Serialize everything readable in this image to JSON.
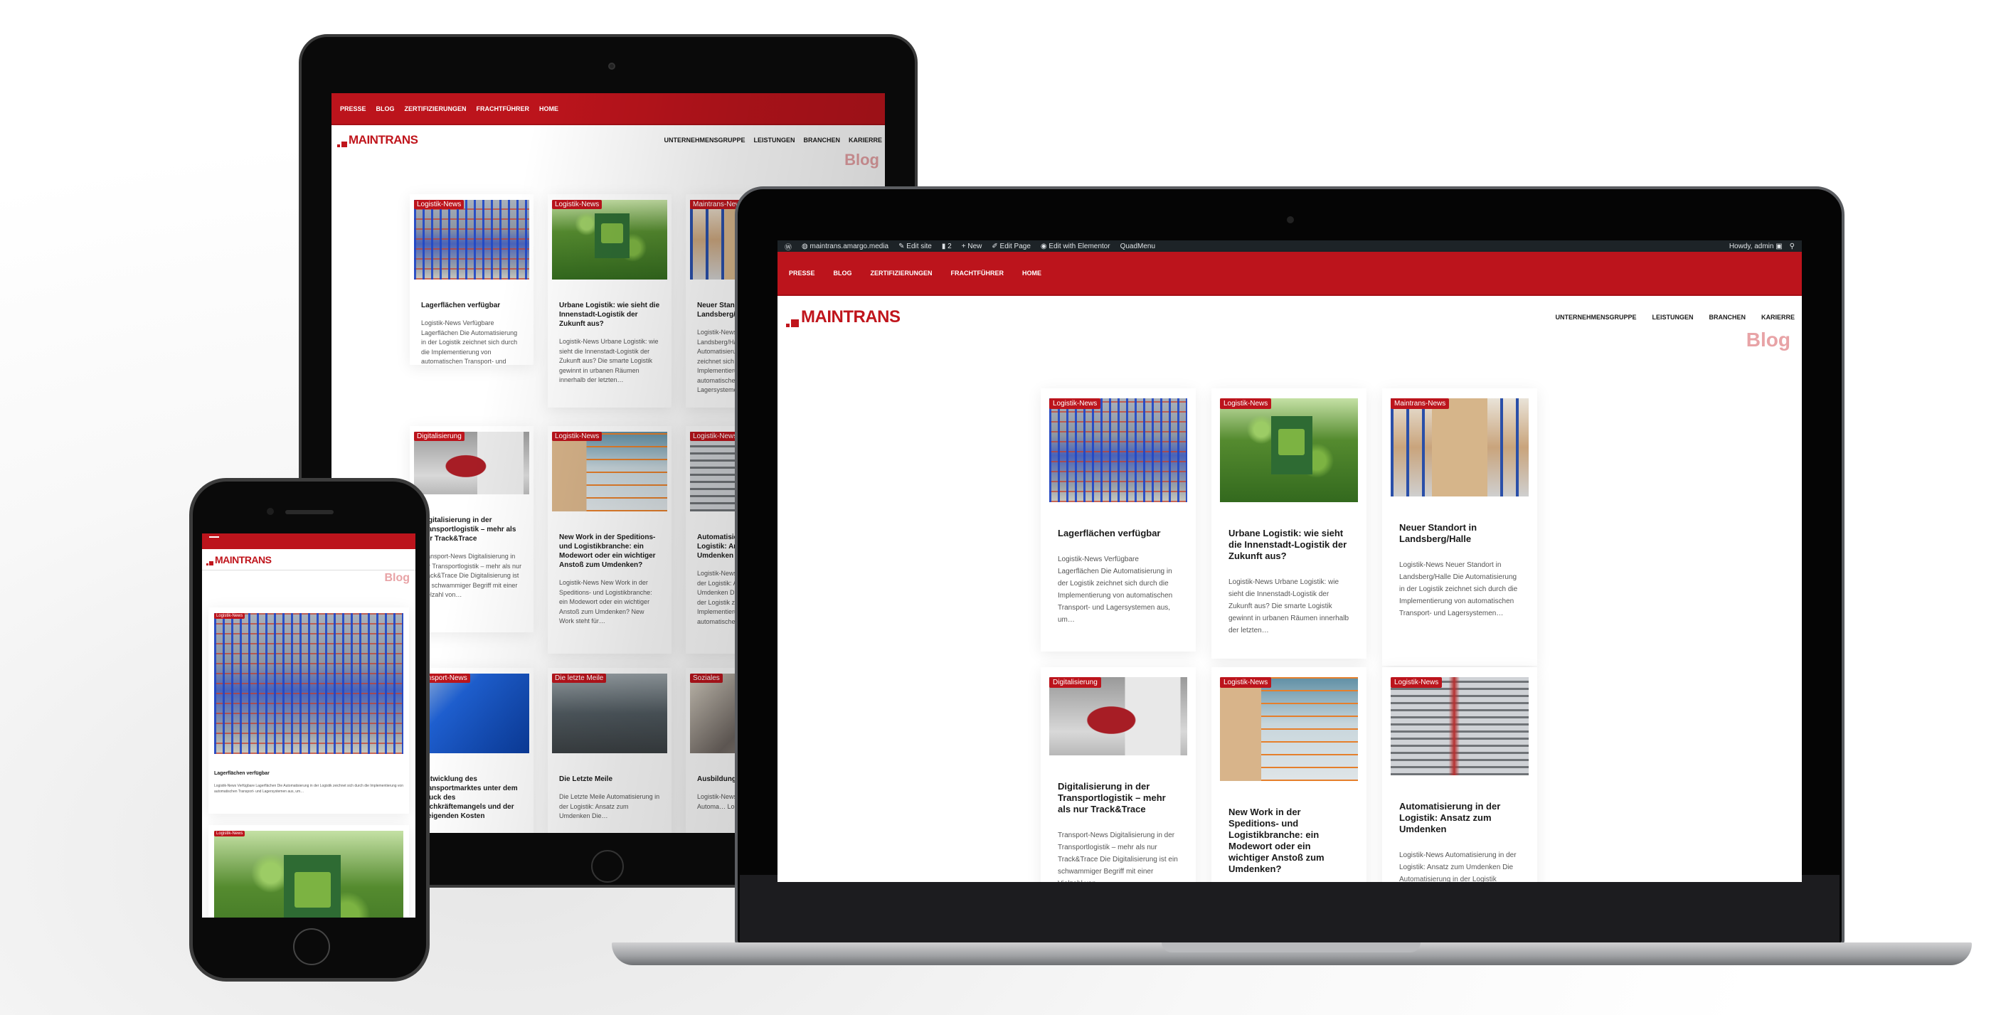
{
  "scene": {
    "description": "Responsive website mockup on tablet, laptop and phone",
    "colors": {
      "brand_red": "#bc141c",
      "admin_bar": "#1d2327",
      "blog_title": "#e8a3a6",
      "text_dark": "#1a1a1a"
    }
  },
  "admin_bar": {
    "wp_icon": "wordpress-icon",
    "site_icon": "dashboard-icon",
    "site_name": "maintrans.amargo.media",
    "edit_site_icon": "brush-icon",
    "edit_site": "Edit site",
    "comments_icon": "comment-icon",
    "comments_count": "2",
    "new_icon": "plus-icon",
    "new": "New",
    "edit_page_icon": "pencil-icon",
    "edit_page": "Edit Page",
    "elementor_icon": "elementor-icon",
    "edit_elementor": "Edit with Elementor",
    "quadmenu": "QuadMenu",
    "howdy": "Howdy, admin",
    "avatar_icon": "avatar-icon",
    "search_icon": "search-icon"
  },
  "top_nav": [
    "PRESSE",
    "BLOG",
    "ZERTIFIZIERUNGEN",
    "FRACHTFÜHRER",
    "HOME"
  ],
  "logo": {
    "text": "MAINTRANS"
  },
  "main_nav": [
    "UNTERNEHMENSGRUPPE",
    "LEISTUNGEN",
    "BRANCHEN",
    "KARIERRE"
  ],
  "page_title": "Blog",
  "posts": [
    {
      "category": "Logistik-News",
      "title": "Lagerflächen verfügbar",
      "excerpt": "Logistik-News Verfügbare Lagerflächen Die Automatisierung in der Logistik zeichnet sich durch die Implementierung von automatischen Transport- und Lagersystemen aus, um…",
      "image": "warehouse-racks"
    },
    {
      "category": "Logistik-News",
      "title": "Urbane Logistik: wie sieht die Innenstadt-Logistik der Zukunft aus?",
      "excerpt": "Logistik-News Urbane Logistik: wie sieht die Innenstadt-Logistik der Zukunft aus? Die smarte Logistik gewinnt in urbanen Räumen innerhalb der letzten…",
      "image": "forest-truck-sign"
    },
    {
      "category": "Maintrans-News",
      "title": "Neuer Standort in Landsberg/Halle",
      "excerpt": "Logistik-News Neuer Standort in Landsberg/Halle Die Automatisierung in der Logistik zeichnet sich durch die Implementierung von automatischen Transport- und Lagersystemen…",
      "image": "workers-boxes"
    },
    {
      "category": "Digitalisierung",
      "title": "Digitalisierung in der Transportlogistik – mehr als nur Track&Trace",
      "excerpt": "Transport-News Digitalisierung in der Transportlogistik – mehr als nur Track&Trace Die Digitalisierung ist ein schwammiger Begriff mit einer Vielzahl von…",
      "image": "red-truck"
    },
    {
      "category": "Logistik-News",
      "title": "New Work in der Speditions- und Logistikbranche: ein Modewort oder ein wichtiger Anstoß zum Umdenken?",
      "excerpt": "Logistik-News New Work in der Speditions- und Logistikbranche: ein Modewort oder ein wichtiger Anstoß zum Umdenken? New Work steht für…",
      "image": "agv-warehouse"
    },
    {
      "category": "Logistik-News",
      "title": "Automatisierung in der Logistik: Ansatz zum Umdenken",
      "excerpt": "Logistik-News Automatisierung in der Logistik: Ansatz zum Umdenken Die Automatisierung in der Logistik zeichnet sich durch die Implementierung von automatischen…",
      "image": "asrs-system"
    },
    {
      "category": "Transport-News",
      "title": "Entwicklung des Transportmarktes unter dem Druck des Fachkräftemangels und der steigenden Kosten",
      "excerpt": "",
      "image": "blue-truck"
    },
    {
      "category": "Die letzte Meile",
      "title": "Die Letzte Meile",
      "excerpt": "Die Letzte Meile Automatisierung in der Logistik: Ansatz zum Umdenken Die…",
      "image": "traffic"
    },
    {
      "category": "Soziales",
      "title": "Ausbildung…",
      "excerpt": "Logistik-News Ausbildungs… Die Automa… Logistik zeic…",
      "image": "people-writing"
    }
  ]
}
